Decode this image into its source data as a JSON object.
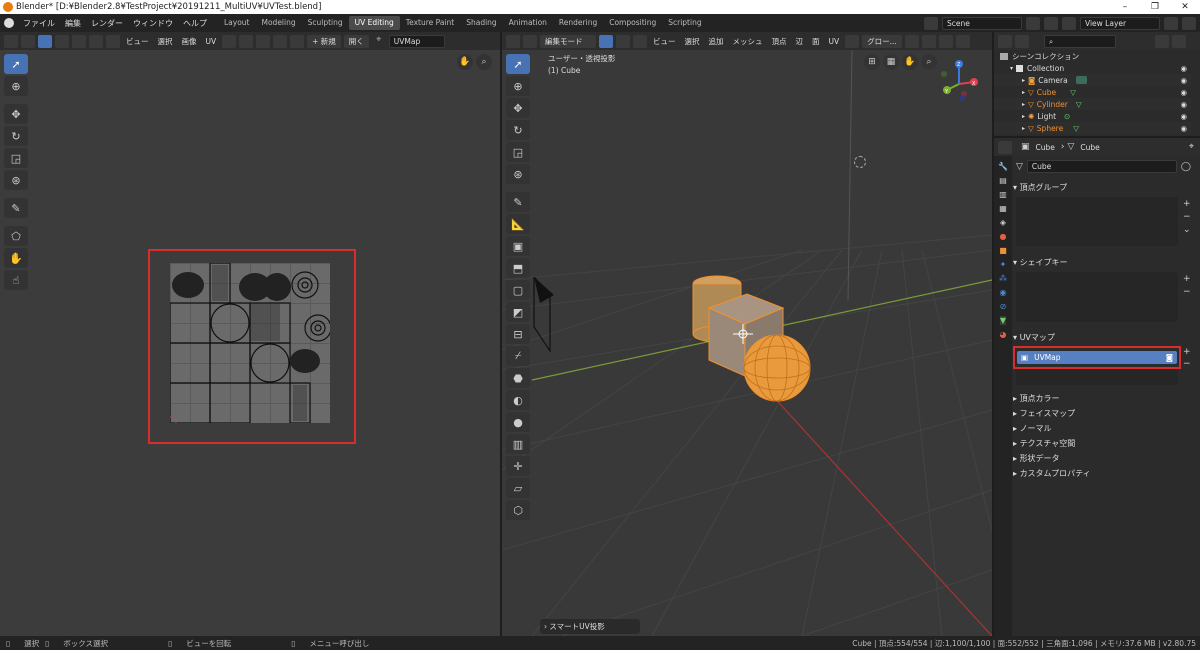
{
  "window": {
    "title": "Blender* [D:¥Blender2.8¥TestProject¥20191211_MultiUV¥UVTest.blend]",
    "minimize": "–",
    "maximize": "❐",
    "close": "✕"
  },
  "menus": [
    "ファイル",
    "編集",
    "レンダー",
    "ウィンドウ",
    "ヘルプ"
  ],
  "workspaces": [
    "Layout",
    "Modeling",
    "Sculpting",
    "UV Editing",
    "Texture Paint",
    "Shading",
    "Animation",
    "Rendering",
    "Compositing",
    "Scripting"
  ],
  "active_workspace": "UV Editing",
  "scene_field": "Scene",
  "viewlayer_field": "View Layer",
  "uv_editor": {
    "menus": [
      "ビュー",
      "選択",
      "画像",
      "UV"
    ],
    "new_label": "+ 新規",
    "open_label": "開く",
    "uvmap_field": "UVMap"
  },
  "viewport": {
    "mode": "編集モード",
    "menus": [
      "ビュー",
      "選択",
      "追加",
      "メッシュ",
      "頂点",
      "辺",
      "面",
      "UV"
    ],
    "transform": "グロー...",
    "overlay_title": "ユーザー・透視投影",
    "overlay_sub": "(1) Cube",
    "operator_panel": "スマートUV投影",
    "axes": [
      "X",
      "Y",
      "Z"
    ]
  },
  "outliner": {
    "title": "シーンコレクション",
    "items": [
      {
        "label": "Collection",
        "selected": false
      },
      {
        "label": "Camera",
        "selected": false
      },
      {
        "label": "Cube",
        "selected": true
      },
      {
        "label": "Cylinder",
        "selected": true
      },
      {
        "label": "Light",
        "selected": false
      },
      {
        "label": "Sphere",
        "selected": true
      }
    ]
  },
  "properties": {
    "breadcrumb_obj": "Cube",
    "breadcrumb_mesh": "Cube",
    "mesh_name": "Cube",
    "sections": {
      "vertex_groups": "頂点グループ",
      "shape_keys": "シェイプキー",
      "uv_maps": "UVマップ",
      "vertex_colors": "頂点カラー",
      "face_maps": "フェイスマップ",
      "normals": "ノーマル",
      "texture_space": "テクスチャ空間",
      "shape_data": "形状データ",
      "custom_props": "カスタムプロパティ"
    },
    "uvmap_item": "UVMap"
  },
  "statusbar": {
    "select": "選択",
    "box_select": "ボックス選択",
    "rotate_view": "ビューを回転",
    "call_menu": "メニュー呼び出し",
    "stats": "Cube | 頂点:554/554 | 辺:1,100/1,100 | 面:552/552 | 三角面:1,096 | メモリ:37.6 MB | v2.80.75"
  },
  "colors": {
    "accent": "#4772b3",
    "highlight": "#d92c2c",
    "selected_obj": "#f09030"
  }
}
